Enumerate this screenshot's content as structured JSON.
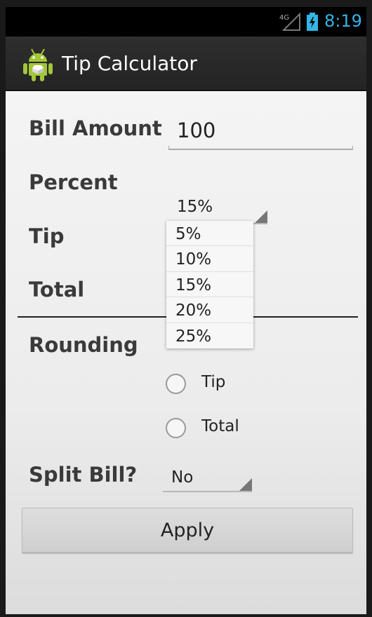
{
  "status_bar": {
    "time": "8:19",
    "network": "4G"
  },
  "action_bar": {
    "title": "Tip Calculator",
    "icon": "android-robot-icon"
  },
  "form": {
    "bill_amount_label": "Bill Amount",
    "bill_amount_value": "100",
    "percent_label": "Percent",
    "percent_value": "15%",
    "tip_label": "Tip",
    "total_label": "Total",
    "rounding_label": "Rounding",
    "rounding_options": [
      {
        "label": "Tip",
        "selected": false
      },
      {
        "label": "Total",
        "selected": false
      }
    ],
    "split_label": "Split Bill?",
    "split_value": "No",
    "apply_label": "Apply"
  },
  "percent_dropdown": {
    "options": [
      "5%",
      "10%",
      "15%",
      "20%",
      "25%"
    ]
  },
  "colors": {
    "status_clock": "#33b5e5",
    "action_bar": "#2a2a2a",
    "content_bg": "#f0f0f0",
    "android_green": "#a4c639"
  }
}
